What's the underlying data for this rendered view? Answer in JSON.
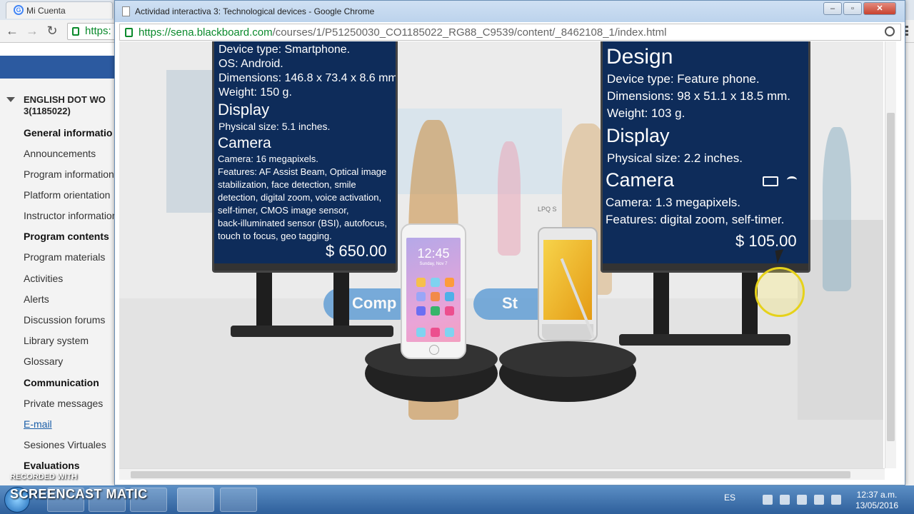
{
  "back_browser": {
    "tab_title": "Mi Cuenta",
    "url_partial": "https:"
  },
  "sidebar": {
    "course_title": "ENGLISH DOT WO 3(1185022)",
    "items": [
      {
        "label": "General informatio",
        "style": "bold"
      },
      {
        "label": "Announcements",
        "style": "normal"
      },
      {
        "label": "Program information",
        "style": "normal"
      },
      {
        "label": "Platform orientation",
        "style": "normal"
      },
      {
        "label": "Instructor information",
        "style": "normal"
      },
      {
        "label": "Program contents",
        "style": "bold"
      },
      {
        "label": "Program materials",
        "style": "normal"
      },
      {
        "label": "Activities",
        "style": "normal"
      },
      {
        "label": "Alerts",
        "style": "normal"
      },
      {
        "label": "Discussion forums",
        "style": "normal"
      },
      {
        "label": "Library system",
        "style": "normal"
      },
      {
        "label": "Glossary",
        "style": "normal"
      },
      {
        "label": "Communication",
        "style": "bold"
      },
      {
        "label": "Private messages",
        "style": "normal"
      },
      {
        "label": "E-mail",
        "style": "link"
      },
      {
        "label": "Sesiones Virtuales",
        "style": "normal"
      },
      {
        "label": "Evaluations",
        "style": "bold"
      }
    ]
  },
  "popup": {
    "title": "Actividad interactiva 3: Technological devices - Google Chrome",
    "url_host": "https://sena.blackboard.com",
    "url_path": "/courses/1/P51250030_CO1185022_RG88_C9539/content/_8462108_1/index.html"
  },
  "left_panel": {
    "specs_top": [
      "Device type: Smartphone.",
      "OS: Android.",
      "Dimensions: 146.8 x 73.4 x 8.6 mm.",
      "Weight: 150 g."
    ],
    "display_title": "Display",
    "display_specs": [
      "Physical size: 5.1 inches."
    ],
    "camera_title": "Camera",
    "camera_specs": [
      "Camera: 16 megapixels.",
      "Features: AF Assist Beam, Optical image",
      "stabilization, face detection, smile",
      "detection, digital zoom, voice activation,",
      "self-timer, CMOS image sensor,",
      "back-illuminated sensor (BSI), autofocus,",
      "touch to focus, geo tagging."
    ],
    "price": "$ 650.00"
  },
  "right_panel": {
    "design_title": "Design",
    "design_specs": [
      "Device type: Feature phone.",
      "Dimensions: 98 x 51.1 x 18.5 mm.",
      "Weight: 103 g."
    ],
    "display_title": "Display",
    "display_specs": [
      "Physical size: 2.2 inches."
    ],
    "camera_title": "Camera",
    "camera_specs": [
      "Camera: 1.3 megapixels.",
      "Features: digital zoom, self-timer."
    ],
    "price": "$ 105.00"
  },
  "scene": {
    "button_left": "Comp",
    "button_right": "St",
    "phone_time": "12:45",
    "phone_date": "Sunday, Nov 7",
    "feature_phone_label": "LPQ S"
  },
  "taskbar": {
    "watermark_small": "RECORDED WITH",
    "watermark_big": "SCREENCAST   MATIC",
    "lang": "ES",
    "time": "12:37 a.m.",
    "date": "13/05/2016"
  },
  "colors": {
    "panel_bg": "#0e2c5a",
    "accent_blue": "#5b9bd5",
    "highlight_yellow": "#e6d21a",
    "url_green": "#0a8a2c"
  }
}
